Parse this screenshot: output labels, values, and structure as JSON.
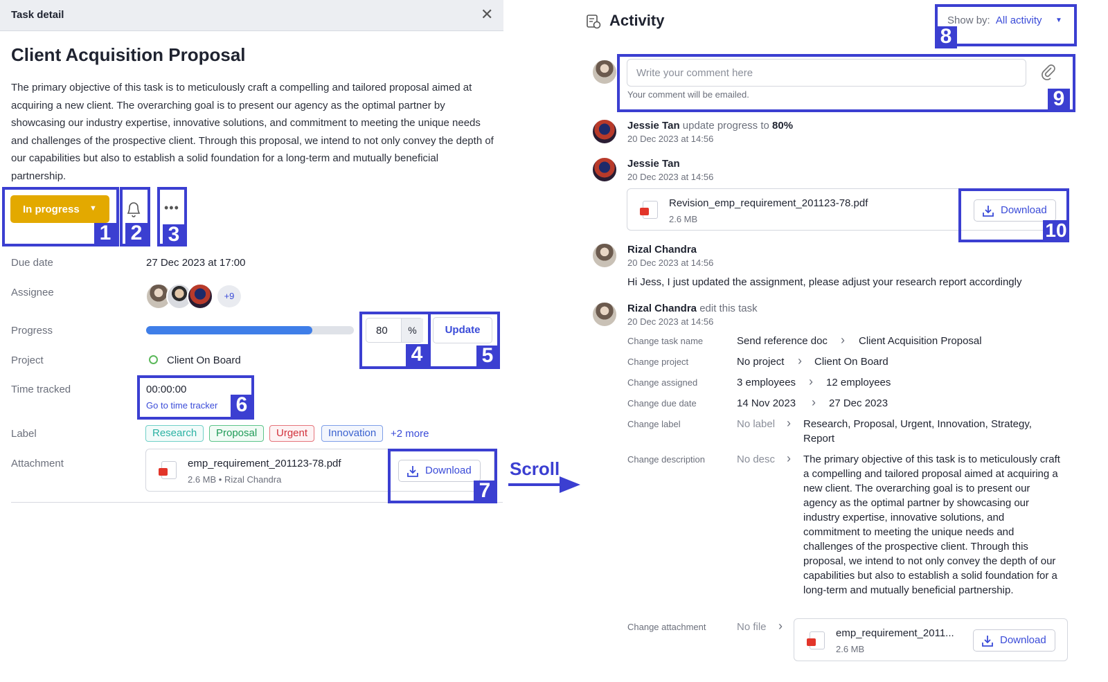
{
  "task": {
    "header_title": "Task detail",
    "title": "Client Acquisition Proposal",
    "description": "The primary objective of this task is to meticulously craft a compelling and tailored proposal aimed at acquiring a new client. The overarching goal is to present our agency as the optimal partner by showcasing our industry expertise, innovative solutions, and commitment to meeting the unique needs and challenges of the prospective client. Through this proposal, we intend to not only convey the depth of our capabilities but also to establish a solid foundation for a long-term and mutually beneficial partnership.",
    "status_label": "In progress",
    "due_label": "Due date",
    "due_value": "27 Dec 2023 at 17:00",
    "assignee_label": "Assignee",
    "assignee_more": "+9",
    "progress_label": "Progress",
    "progress_value": 80,
    "progress_value_text": "80",
    "progress_unit": "%",
    "update_label": "Update",
    "project_label": "Project",
    "project_value": "Client On Board",
    "time_label": "Time tracked",
    "time_value": "00:00:00",
    "time_link": "Go to time tracker",
    "label_label": "Label",
    "labels": [
      "Research",
      "Proposal",
      "Urgent",
      "Innovation"
    ],
    "labels_more": "+2 more",
    "attachment_label": "Attachment",
    "attachment_name": "emp_requirement_201123-78.pdf",
    "attachment_meta": "2.6 MB • Rizal Chandra",
    "download_label": "Download"
  },
  "scroll_label": "Scroll",
  "activity": {
    "title": "Activity",
    "show_by_label": "Show by:",
    "show_by_value": "All activity",
    "comment_placeholder": "Write your comment here",
    "comment_hint": "Your comment will be emailed.",
    "entries": [
      {
        "name": "Jessie Tan",
        "action": "update progress to",
        "value": "80%",
        "time": "20 Dec 2023 at 14:56"
      },
      {
        "name": "Jessie Tan",
        "time": "20 Dec 2023 at 14:56",
        "file_name": "Revision_emp_requirement_201123-78.pdf",
        "file_size": "2.6 MB",
        "download": "Download"
      },
      {
        "name": "Rizal Chandra",
        "time": "20 Dec 2023 at 14:56",
        "message": "Hi Jess, I just updated the assignment, please adjust your research report accordingly"
      },
      {
        "name": "Rizal Chandra",
        "action": "edit this task",
        "time": "20 Dec 2023 at 14:56"
      }
    ],
    "history": [
      {
        "label": "Change task name",
        "old": "Send reference doc",
        "new": "Client Acquisition Proposal"
      },
      {
        "label": "Change project",
        "old": "No project",
        "new": "Client On Board"
      },
      {
        "label": "Change assigned",
        "old": "3 employees",
        "new": "12 employees"
      },
      {
        "label": "Change due date",
        "old": "14 Nov 2023",
        "new": "27 Dec 2023"
      },
      {
        "label": "Change label",
        "old": "No label",
        "new": "Research, Proposal, Urgent, Innovation, Strategy, Report"
      },
      {
        "label": "Change description",
        "old": "No desc",
        "new": "The primary objective of this task is to meticulously craft a compelling and tailored proposal aimed at acquiring a new client. The overarching goal is to present our agency as the optimal partner by showcasing our industry expertise, innovative solutions, and commitment to meeting the unique needs and challenges of the prospective client. Through this proposal, we intend to not only convey the depth of our capabilities but also to establish a solid foundation for a long-term and mutually beneficial partnership."
      },
      {
        "label": "Change attachment",
        "old": "No file",
        "file_name": "emp_requirement_2011...",
        "file_size": "2.6 MB",
        "download": "Download"
      }
    ]
  },
  "annotations": [
    "1",
    "2",
    "3",
    "4",
    "5",
    "6",
    "7",
    "8",
    "9",
    "10"
  ],
  "colors": {
    "accent": "#3a4bd8",
    "status": "#e3a900",
    "annotation": "#3b3fd1",
    "progress": "#3f7ee8"
  }
}
